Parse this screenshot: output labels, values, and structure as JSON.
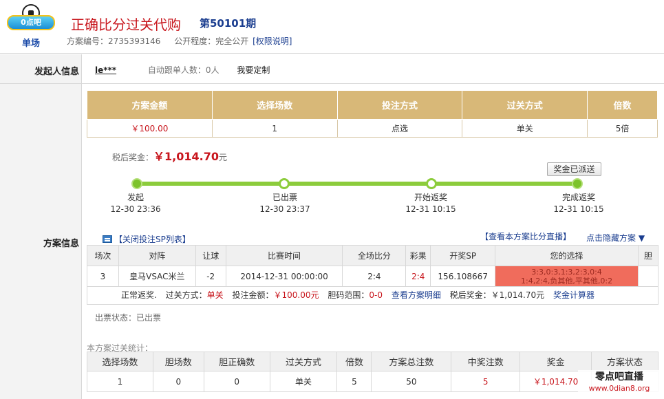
{
  "header": {
    "logo_banner": "0点吧",
    "logo_text": "单场",
    "title": "正确比分过关代购",
    "issue": "第50101期",
    "plan_no_label": "方案编号：",
    "plan_no": "2735393146",
    "publicity_label": "公开程度：",
    "publicity": "完全公开",
    "perm_link": "[权限说明]"
  },
  "initiator": {
    "label": "发起人信息",
    "name": "le***",
    "auto_follow": "自动跟单人数：0人",
    "custom": "我要定制"
  },
  "plan_info_label": "方案信息",
  "summary": {
    "headers": [
      "方案金额",
      "选择场数",
      "投注方式",
      "过关方式",
      "倍数"
    ],
    "values": [
      "￥100.00",
      "1",
      "点选",
      "单关",
      "5倍"
    ]
  },
  "after_tax": {
    "label": "税后奖金：",
    "amount": "￥1,014.70",
    "unit": "元"
  },
  "prize_button": "奖金已派送",
  "progress": [
    {
      "name": "发起",
      "time": "12-30 23:36"
    },
    {
      "name": "已出票",
      "time": "12-30 23:37"
    },
    {
      "name": "开始返奖",
      "time": "12-31 10:15"
    },
    {
      "name": "完成返奖",
      "time": "12-31 10:15"
    }
  ],
  "selection": {
    "close_link": "【关闭投注SP列表】",
    "live_link": "【查看本方案比分直播】",
    "hide_link": "点击隐藏方案 ▼",
    "headers": [
      "场次",
      "对阵",
      "让球",
      "比赛时间",
      "全场比分",
      "彩果",
      "开奖SP",
      "您的选择",
      "胆"
    ],
    "row": {
      "no": "3",
      "match": "皇马VSAC米兰",
      "handicap": "-2",
      "time": "2014-12-31 00:00:00",
      "score": "2:4",
      "result": "2:4",
      "sp": "156.108667",
      "choice_line1": "3:3,0:3,1:3,2:3,0:4",
      "choice_line2": "1:4,2:4,负其他,平其他,0:2",
      "banker": ""
    },
    "details": {
      "status": "正常返奖.",
      "pass_label": "过关方式：",
      "pass_value": "单关",
      "bet_label": "投注金额：",
      "bet_value": "￥100.00元",
      "banker_label": "胆码范围：",
      "banker_value": "0-0",
      "view_detail": "查看方案明细",
      "tax_label": "税后奖金：",
      "tax_value": "￥1,014.70元",
      "calculator": "奖金计算器"
    }
  },
  "ticket_status": "出票状态：已出票",
  "stats": {
    "caption": "本方案过关统计：",
    "headers": [
      "选择场数",
      "胆场数",
      "胆正确数",
      "过关方式",
      "倍数",
      "方案总注数",
      "中奖注数",
      "奖金",
      "方案状态"
    ],
    "values": [
      "1",
      "0",
      "0",
      "单关",
      "5",
      "50",
      "5",
      "￥1,014.70",
      ""
    ]
  },
  "watermark": {
    "line1": "零点吧直播",
    "line2": "www.0dian8.org"
  }
}
